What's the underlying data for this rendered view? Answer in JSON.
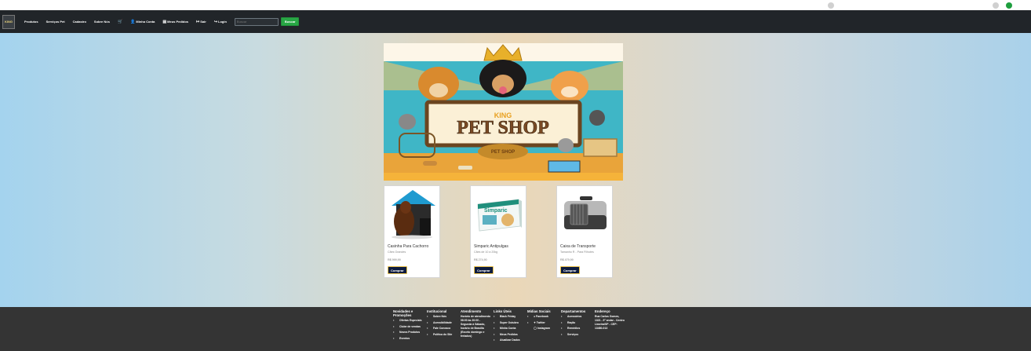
{
  "colors": {
    "navbar": "#212529",
    "search_button": "#28a745",
    "buy_button": "#0d1b3e",
    "footer": "#343434"
  },
  "navbar": {
    "logo_text": "KING",
    "items": [
      {
        "label": "Produtos",
        "icon": ""
      },
      {
        "label": "Serviços Pet",
        "icon": ""
      },
      {
        "label": "Cadastro",
        "icon": ""
      },
      {
        "label": "Sobre Nós",
        "icon": ""
      },
      {
        "label": "",
        "icon": "cart-icon"
      },
      {
        "label": "Minha Conta",
        "icon": "user-icon"
      },
      {
        "label": "Meus Pedidos",
        "icon": "list-icon"
      },
      {
        "label": "Sair",
        "icon": "logout-icon"
      },
      {
        "label": "Login",
        "icon": "login-icon"
      }
    ],
    "search": {
      "placeholder": "Buscar",
      "button": "Buscar"
    }
  },
  "banner": {
    "brand": "KING",
    "title": "PET SHOP",
    "sign": "PET SHOP"
  },
  "products": [
    {
      "name": "Casinha Para Cachorro",
      "subtitle": "Cães Grandes",
      "price": "R$ 999,99",
      "button": "Comprar",
      "image": "dog-house-image"
    },
    {
      "name": "Simparic Antipulgas",
      "subtitle": "Cães de 10 a 20kg",
      "price": "R$ 274,90",
      "button": "Comprar",
      "image": "medicine-box-image"
    },
    {
      "name": "Caixa de Transporte",
      "subtitle": "Tamanho R - Para Filhotes",
      "price": "R$ 479,99",
      "button": "Comprar",
      "image": "pet-carrier-image"
    }
  ],
  "footer": {
    "columns": [
      {
        "title": "Novidades e Promoções",
        "items": [
          "Ofertas Especiais",
          "Clube de vendas",
          "Novos Produtos",
          "Eventos"
        ]
      },
      {
        "title": "Institucional",
        "items": [
          "Sobre Nós",
          "Acessibilidade",
          "Fale Conosco",
          "Política do Site"
        ]
      },
      {
        "title": "Atendimento",
        "text": "Horário de atendimento 08:00 às 20:00 - Segunda à Sábado, horário de Brasília (Exceto domingo e feriados)"
      },
      {
        "title": "Links Úteis",
        "items": [
          "Black Friday",
          "Super Outubro",
          "Minha Conta",
          "Meus Pedidos",
          "Atualizar Dados"
        ]
      },
      {
        "title": "Mídias Sociais",
        "items": [
          "Facebook",
          "Twitter",
          "Instagram"
        ]
      },
      {
        "title": "Departamentos",
        "items": [
          "Acessórios",
          "Ração",
          "Remédios",
          "Serviços"
        ]
      },
      {
        "title": "Endereço",
        "text": "Rua Carlos Gomes, 1321 - 9° andar - Centro Limeira/SP - CEP: 13480-013"
      }
    ]
  }
}
